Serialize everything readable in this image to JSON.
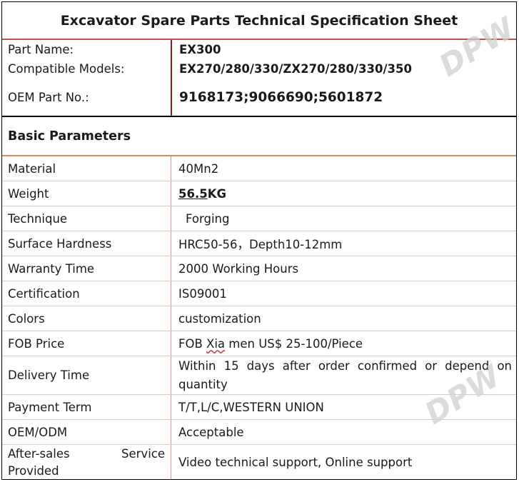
{
  "title": "Excavator Spare Parts Technical Specification Sheet",
  "header_rows": [
    {
      "label": "Part Name:",
      "value": "EX300"
    },
    {
      "label": "Compatible Models:",
      "value": "EX270/280/330/ZX270/280/330/350"
    },
    {
      "label": "OEM Part No.:",
      "value": "9168173;9066690;5601872"
    }
  ],
  "section_title": "Basic Parameters",
  "params": [
    {
      "label": "Material",
      "value": "40Mn2"
    },
    {
      "label": "Weight",
      "value_main": "56.5",
      "value_unit": "KG"
    },
    {
      "label": "Technique",
      "value": "Forging"
    },
    {
      "label": "Surface Hardness",
      "value": "HRC50-56，Depth10-12mm"
    },
    {
      "label": "Warranty Time",
      "value": "2000 Working Hours"
    },
    {
      "label": "Certification",
      "value": "IS09001"
    },
    {
      "label": "Colors",
      "value": "customization"
    },
    {
      "label": "FOB Price",
      "value_pre": "FOB ",
      "value_wavy": "Xia",
      "value_post": " men US$ 25-100/Piece"
    },
    {
      "label": "Delivery Time",
      "value": "Within 15 days after order confirmed or depend on quantity"
    },
    {
      "label": "Payment Term",
      "value": "T/T,L/C,WESTERN UNION"
    },
    {
      "label": "OEM/ODM",
      "value": "Acceptable"
    },
    {
      "label_a": "After-sales",
      "label_b": "Service",
      "label_c": "Provided",
      "value": "Video technical support, Online support"
    }
  ],
  "watermark": "DPW"
}
